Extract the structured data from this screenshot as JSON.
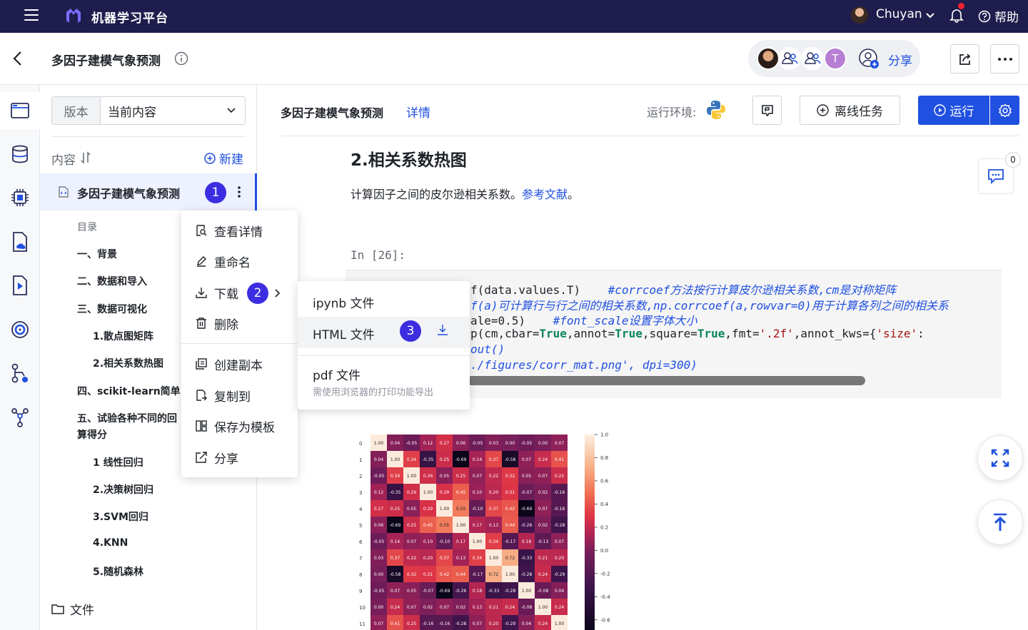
{
  "topbar": {
    "app_title": "机器学习平台",
    "user_name": "Chuyan",
    "help_label": "帮助"
  },
  "header": {
    "project_title": "多因子建模气象预测",
    "collab_initial": "T",
    "share_label": "分享"
  },
  "tree": {
    "version_label": "版本",
    "version_value": "当前内容",
    "content_label": "内容",
    "new_label": "新建",
    "file_name": "多因子建模气象预测",
    "toc": [
      "目录",
      "一、背景",
      "二、数据和导入",
      "三、数据可视化",
      "1.散点图矩阵",
      "2.相关系数热图",
      "四、scikit-learn简单",
      "五、试验各种不同的回",
      "算得分",
      "1 线性回归",
      "2.决策树回归",
      "3.SVM回归",
      "4.KNN",
      "5.随机森林"
    ],
    "files_label": "文件"
  },
  "badges": [
    "1",
    "2",
    "3"
  ],
  "context_menu": {
    "items": [
      "查看详情",
      "重命名",
      "下载",
      "删除",
      "创建副本",
      "复制到",
      "保存为模板",
      "分享"
    ]
  },
  "download_submenu": {
    "items": [
      "ipynb 文件",
      "HTML 文件",
      "pdf 文件"
    ],
    "pdf_hint": "需使用浏览器的打印功能导出"
  },
  "main": {
    "notebook_title": "多因子建模气象预测",
    "detail_link": "详情",
    "env_label": "运行环境:",
    "offline_task": "离线任务",
    "run_label": "运行",
    "heading": "2.相关系数热图",
    "desc_text": "计算因子之间的皮尔逊相关系数。",
    "desc_link": "参考文献",
    "desc_end": "。",
    "in_prompt": "In [26]:",
    "comment_count": "0",
    "code": {
      "l1a": "f(data.values.T)    ",
      "l1b": "#corrcoef方法按行计算皮尔逊相关系数,cm是对称矩阵",
      "l2": "f(a)可计算行与行之间的相关系数,np.corrcoef(a,rowvar=0)用于计算各列之间的相关系",
      "l3a": "ale=0.5)    ",
      "l3b": "#font_scale设置字体大小",
      "l4a": "p(cm,cbar=",
      "l4b": "True",
      "l4c": ",annot=",
      "l4d": "True",
      "l4e": ",square=",
      "l4f": "True",
      "l4g": ",fmt=",
      "l4h": "'.2f'",
      "l4i": ",annot_kws={",
      "l4j": "'size'",
      "l4k": ":",
      "l5": "out()",
      "l6": "./figures/corr_mat.png', dpi=300)"
    }
  },
  "heatmap": {
    "row_labels": [
      "0",
      "1",
      "2",
      "3",
      "4",
      "5",
      "6",
      "7",
      "8",
      "9",
      "10",
      "11"
    ],
    "values": [
      [
        "1.00",
        "0.04",
        "-0.05",
        "0.12",
        "0.27",
        "0.06",
        "-0.05",
        "0.03",
        "0.00",
        "-0.05",
        "0.00",
        "0.07"
      ],
      [
        "0.04",
        "1.00",
        "0.34",
        "-0.35",
        "0.25",
        "-0.69",
        "0.14",
        "0.37",
        "-0.58",
        "0.07",
        "0.24",
        "0.41"
      ],
      [
        "-0.05",
        "0.34",
        "1.00",
        "0.26",
        "0.05",
        "0.25",
        "0.07",
        "0.22",
        "0.32",
        "0.05",
        "0.07",
        "0.25"
      ],
      [
        "0.12",
        "-0.35",
        "0.26",
        "1.00",
        "0.29",
        "0.45",
        "0.10",
        "0.20",
        "0.31",
        "-0.07",
        "0.02",
        "-0.16"
      ],
      [
        "0.27",
        "0.25",
        "0.05",
        "0.29",
        "1.00",
        "0.55",
        "-0.10",
        "0.37",
        "0.42",
        "-0.69",
        "0.07",
        "-0.16"
      ],
      [
        "0.06",
        "-0.69",
        "0.25",
        "0.45",
        "0.55",
        "1.00",
        "0.17",
        "0.13",
        "0.44",
        "-0.26",
        "0.02",
        "-0.28"
      ],
      [
        "-0.05",
        "0.14",
        "0.07",
        "0.10",
        "-0.10",
        "0.17",
        "1.00",
        "0.34",
        "-0.17",
        "0.18",
        "-0.13",
        "0.07"
      ],
      [
        "0.03",
        "0.37",
        "0.22",
        "0.20",
        "0.37",
        "0.13",
        "0.34",
        "1.00",
        "0.72",
        "-0.33",
        "0.21",
        "0.20"
      ],
      [
        "0.00",
        "-0.58",
        "0.32",
        "0.31",
        "0.42",
        "0.44",
        "-0.17",
        "0.72",
        "1.00",
        "-0.28",
        "0.24",
        "-0.29"
      ],
      [
        "-0.05",
        "0.07",
        "0.05",
        "-0.07",
        "-0.69",
        "-0.26",
        "0.18",
        "-0.33",
        "-0.28",
        "1.00",
        "-0.08",
        "0.04"
      ],
      [
        "0.00",
        "0.24",
        "0.07",
        "0.02",
        "0.07",
        "0.02",
        "0.13",
        "0.21",
        "0.24",
        "-0.08",
        "1.00",
        "0.24"
      ],
      [
        "0.07",
        "0.41",
        "0.25",
        "-0.16",
        "-0.16",
        "-0.28",
        "0.07",
        "0.20",
        "-0.29",
        "0.04",
        "0.24",
        "1.00"
      ]
    ],
    "cbar_ticks": [
      "1.0",
      "0.8",
      "0.6",
      "0.4",
      "0.2",
      "0.0",
      "-0.2",
      "-0.4",
      "-0.6"
    ]
  },
  "colors": {
    "topbar": "#1f1d4d",
    "accent": "#2050e0",
    "badge": "#3c2ee0"
  }
}
